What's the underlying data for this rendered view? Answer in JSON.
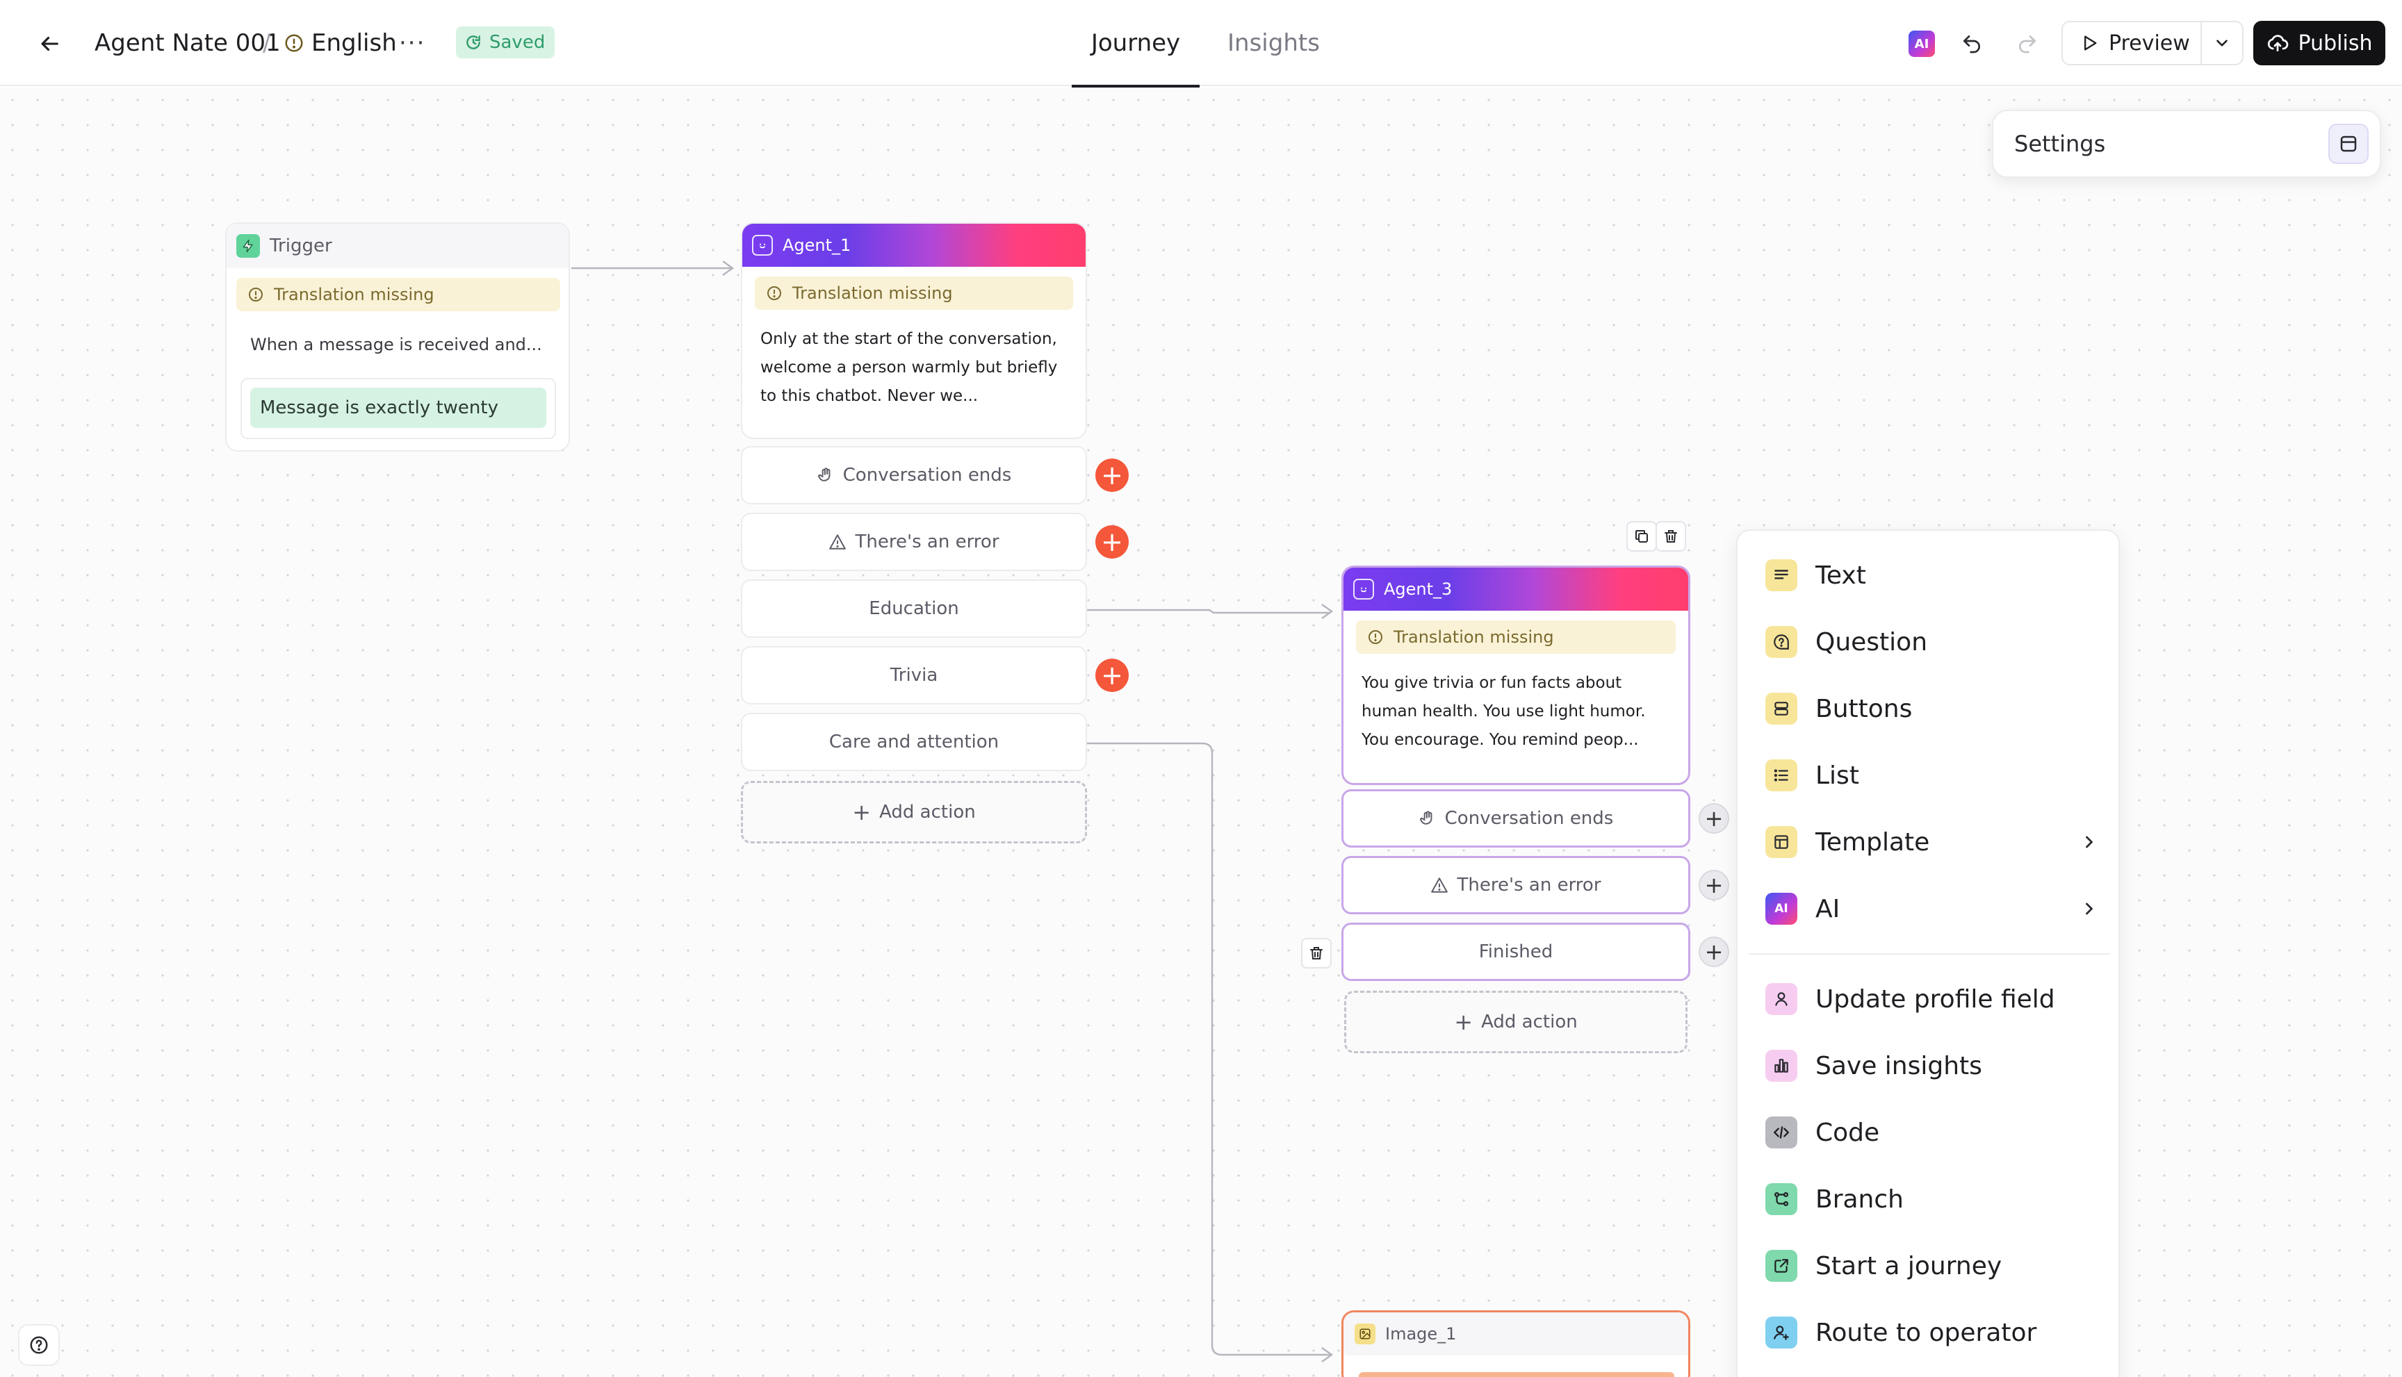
{
  "header": {
    "agent_name": "Agent Nate 001",
    "separator": "/",
    "language": "English",
    "more": "···",
    "saved": "Saved",
    "tabs": [
      {
        "label": "Journey",
        "active": true
      },
      {
        "label": "Insights",
        "active": false
      }
    ],
    "ai_badge": "AI",
    "preview": "Preview",
    "publish": "Publish"
  },
  "settings": {
    "label": "Settings"
  },
  "trigger": {
    "title": "Trigger",
    "warning": "Translation missing",
    "description": "When a message is received and...",
    "condition": "Message is exactly twenty"
  },
  "agent1": {
    "title": "Agent_1",
    "warning": "Translation missing",
    "body": "Only at the start of the conversation, welcome a person warmly but briefly to this chatbot. Never we...",
    "actions": [
      "Conversation ends",
      "There's an error",
      "Education",
      "Trivia",
      "Care and attention"
    ],
    "add_action": "Add action"
  },
  "agent3": {
    "title": "Agent_3",
    "warning": "Translation missing",
    "body": "You give trivia or fun facts about human health. You use light humor. You encourage. You remind peop...",
    "actions": [
      "Conversation ends",
      "There's an error",
      "Finished"
    ],
    "add_action": "Add action"
  },
  "image1": {
    "title": "Image_1"
  },
  "block_menu": {
    "items": [
      {
        "label": "Text",
        "icon": "text-icon"
      },
      {
        "label": "Question",
        "icon": "question-icon"
      },
      {
        "label": "Buttons",
        "icon": "buttons-icon"
      },
      {
        "label": "List",
        "icon": "list-icon"
      },
      {
        "label": "Template",
        "icon": "template-icon",
        "submenu": true
      },
      {
        "label": "AI",
        "icon": "ai-icon",
        "submenu": true
      },
      {
        "label": "Update profile field",
        "icon": "user-icon"
      },
      {
        "label": "Save insights",
        "icon": "chart-icon"
      },
      {
        "label": "Code",
        "icon": "code-icon"
      },
      {
        "label": "Branch",
        "icon": "branch-icon"
      },
      {
        "label": "Start a journey",
        "icon": "external-link-icon"
      },
      {
        "label": "Route to operator",
        "icon": "operator-icon"
      }
    ]
  },
  "colors": {
    "accent_red": "#f4573a",
    "saved_green": "#2f9d6a",
    "warning_bg": "#faf2d7",
    "selection": "#c9a6e8",
    "image_border": "#f0855f"
  }
}
